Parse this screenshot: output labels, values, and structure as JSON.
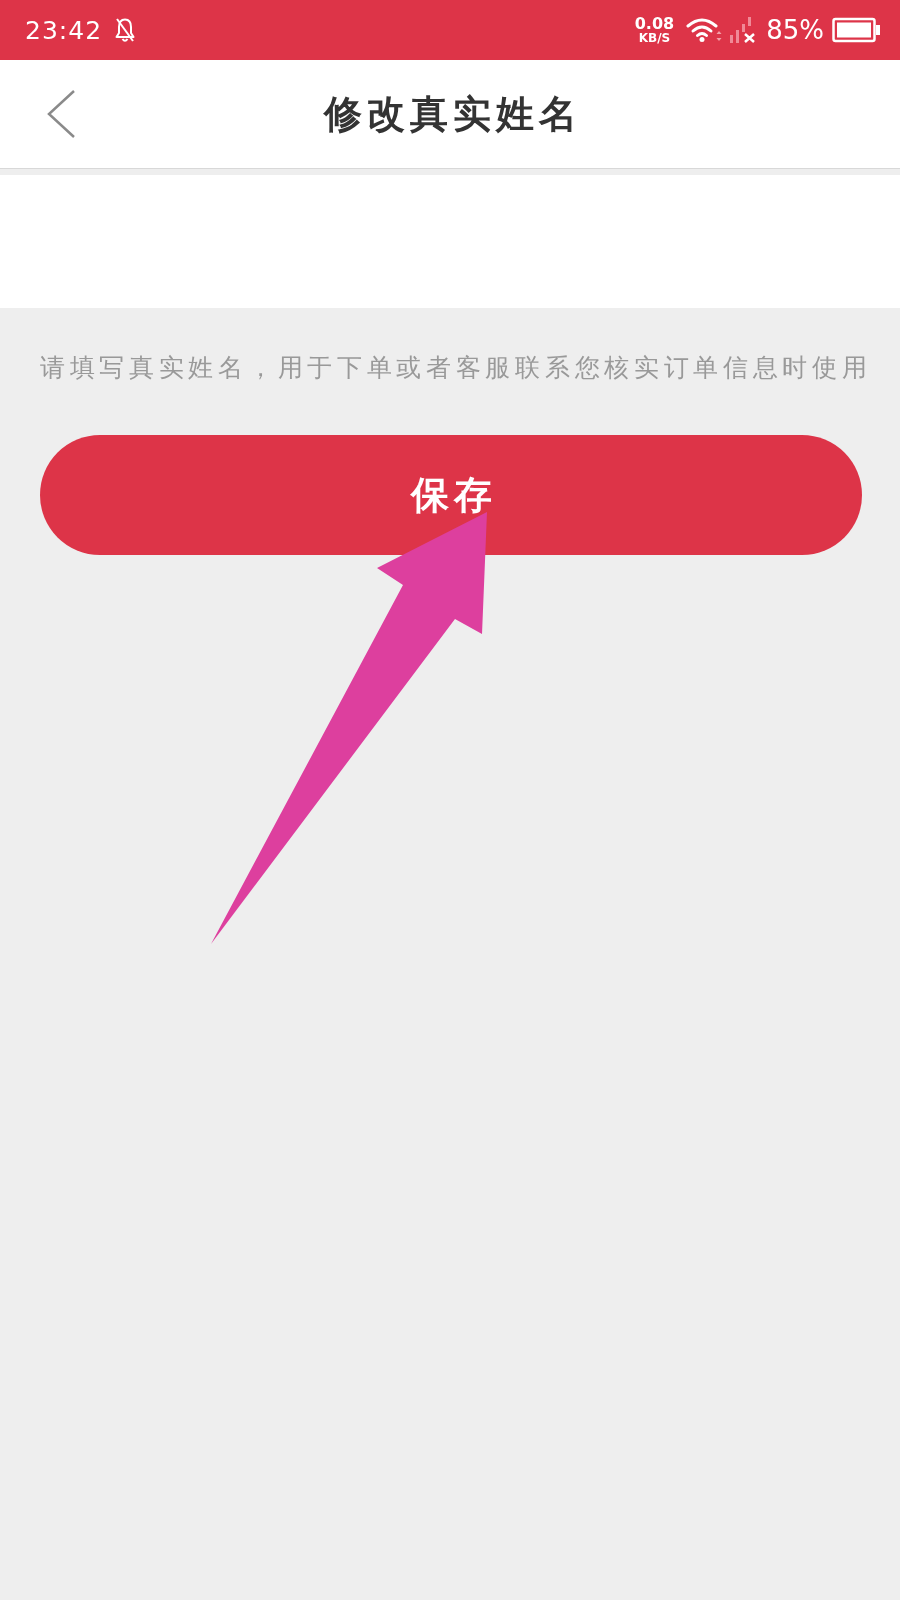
{
  "status_bar": {
    "time": "23:42",
    "network_speed": "0.08",
    "network_speed_unit": "KB/S",
    "battery": "85%"
  },
  "header": {
    "title": "修改真实姓名"
  },
  "hint": "请填写真实姓名，用于下单或者客服联系您核实订单信息时使用",
  "save_button": {
    "label": "保存"
  }
}
